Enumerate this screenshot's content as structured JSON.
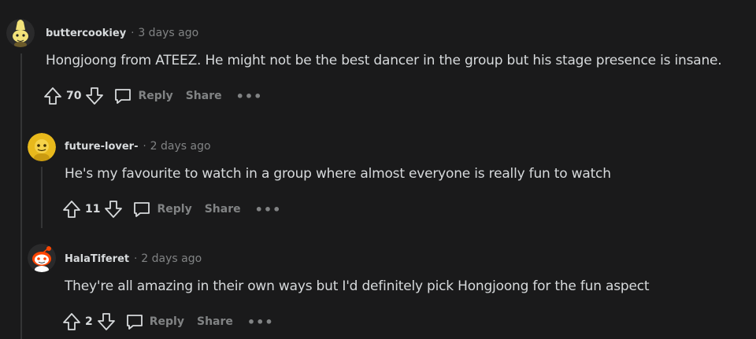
{
  "comments": [
    {
      "username": "buttercookiey",
      "time": "3 days ago",
      "text": "Hongjoong from ATEEZ. He might not be the best dancer in the group but his stage presence is insane.",
      "score": "70",
      "avatar_icon": "snoo-banana-avatar"
    },
    {
      "username": "future-lover-",
      "time": "2 days ago",
      "text": "He's my favourite to watch in a group where almost everyone is really fun to watch",
      "score": "11",
      "avatar_icon": "snoo-yellow-avatar"
    },
    {
      "username": "HalaTiferet",
      "time": "2 days ago",
      "text": "They're all amazing in their own ways but I'd definitely pick Hongjoong for the fun aspect",
      "score": "2",
      "avatar_icon": "snoo-red-avatar"
    }
  ],
  "labels": {
    "separator": "·",
    "reply": "Reply",
    "share": "Share",
    "more": "•••"
  },
  "colors": {
    "background": "#1a1a1b",
    "text": "#d7dadc",
    "muted": "#818384"
  }
}
